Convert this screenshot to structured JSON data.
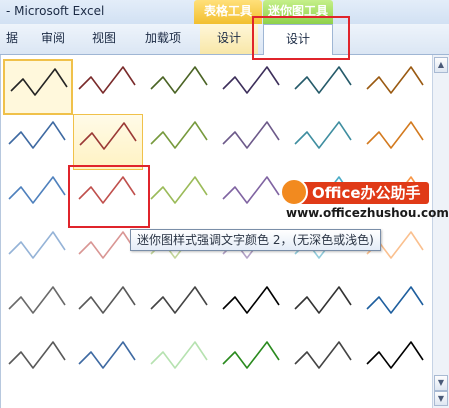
{
  "window": {
    "title": "- Microsoft Excel"
  },
  "context_groups": {
    "table_tools": "表格工具",
    "sparkline_tools": "迷你图工具"
  },
  "tabs": {
    "data": "据",
    "review": "审阅",
    "view": "视图",
    "addins": "加载项",
    "design_table": "设计",
    "design_sparkline": "设计"
  },
  "gallery": {
    "row_colors": [
      [
        "#242424",
        "#7a2b2b",
        "#4b6425",
        "#3d2f5b",
        "#265b6a",
        "#9a5a12"
      ],
      [
        "#3f6aa2",
        "#9b3a36",
        "#779a3d",
        "#6d5a8a",
        "#3f8ea0",
        "#d37a1f"
      ],
      [
        "#4f81bd",
        "#c0504d",
        "#9bbb59",
        "#8064a2",
        "#4bacc6",
        "#f79646"
      ],
      [
        "#95b3d7",
        "#d99694",
        "#c3d69b",
        "#b3a2c7",
        "#93cddd",
        "#fac08f"
      ],
      [
        "#6a6a6a",
        "#595959",
        "#444444",
        "#000000",
        "#333333",
        "#1f5f9e"
      ],
      [
        "#595959",
        "#3f6aa2",
        "#b6e2b0",
        "#2a8a1e",
        "#444444",
        "#000000"
      ]
    ],
    "selected_index": 0,
    "hovered_index": 7
  },
  "scrollbar": {
    "up_icon": "▲",
    "down_icon": "▼",
    "more_icon": "▼"
  },
  "tooltip": {
    "text": "迷你图样式强调文字颜色 2，(无深色或浅色)"
  },
  "watermark": {
    "brand": "Office办公助手",
    "url": "www.officezhushou.com"
  }
}
